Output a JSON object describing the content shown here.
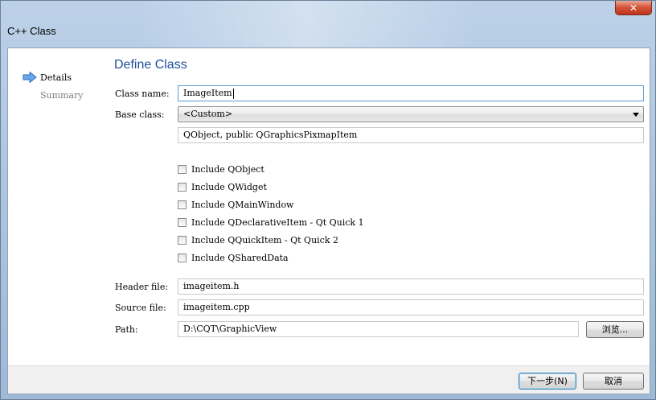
{
  "window": {
    "title": "C++ Class"
  },
  "steps": [
    {
      "label": "Details",
      "active": true
    },
    {
      "label": "Summary",
      "active": false
    }
  ],
  "page": {
    "title": "Define Class",
    "class_name": {
      "label": "Class name:",
      "value": "ImageItem"
    },
    "base_class": {
      "label": "Base class:",
      "selected": "<Custom>"
    },
    "custom_base": {
      "value": "QObject, public QGraphicsPixmapItem"
    },
    "includes": [
      {
        "label": "Include QObject",
        "checked": false
      },
      {
        "label": "Include QWidget",
        "checked": false
      },
      {
        "label": "Include QMainWindow",
        "checked": false
      },
      {
        "label": "Include QDeclarativeItem - Qt Quick 1",
        "checked": false
      },
      {
        "label": "Include QQuickItem - Qt Quick 2",
        "checked": false
      },
      {
        "label": "Include QSharedData",
        "checked": false
      }
    ],
    "header_file": {
      "label": "Header file:",
      "value": "imageitem.h"
    },
    "source_file": {
      "label": "Source file:",
      "value": "imageitem.cpp"
    },
    "path": {
      "label": "Path:",
      "value": "D:\\CQT\\GraphicView",
      "browse_label": "浏览..."
    }
  },
  "buttons": {
    "next": "下一步(N)",
    "cancel": "取消"
  },
  "colors": {
    "title_accent": "#1f4e9a",
    "arrow": "#3a7fd5"
  }
}
